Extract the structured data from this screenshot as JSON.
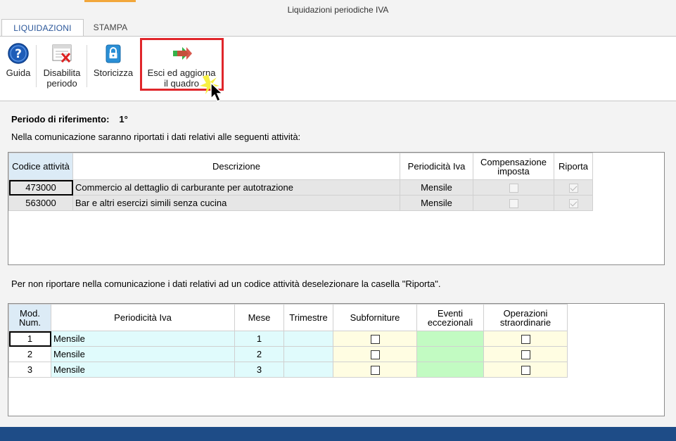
{
  "window": {
    "title": "Liquidazioni periodiche IVA"
  },
  "tabs": [
    {
      "label": "LIQUIDAZIONI",
      "active": true
    },
    {
      "label": "STAMPA",
      "active": false
    }
  ],
  "ribbon": {
    "guida": {
      "label": "Guida",
      "icon": "help-icon"
    },
    "disabilita": {
      "line1": "Disabilita",
      "line2": "periodo",
      "icon": "disable-period-icon"
    },
    "storicizza": {
      "label": "Storicizza",
      "icon": "lock-icon"
    },
    "esci": {
      "line1": "Esci ed aggiorna",
      "line2": "il quadro",
      "icon": "arrow-right-icon"
    }
  },
  "content": {
    "ref_label": "Periodo di riferimento:",
    "ref_value": "1°",
    "note1": "Nella comunicazione saranno riportati i dati relativi alle seguenti attività:",
    "note2": "Per non riportare nella comunicazione i dati relativi ad un codice attività deselezionare la casella \"Riporta\"."
  },
  "activities": {
    "headers": {
      "codice": "Codice attività",
      "descrizione": "Descrizione",
      "periodicita": "Periodicità Iva",
      "compensazione": "Compensazione imposta",
      "riporta": "Riporta"
    },
    "rows": [
      {
        "codice": "473000",
        "descrizione": "Commercio al dettaglio di carburante per autotrazione",
        "periodicita": "Mensile",
        "compensazione": false,
        "riporta": true
      },
      {
        "codice": "563000",
        "descrizione": "Bar e altri esercizi simili senza cucina",
        "periodicita": "Mensile",
        "compensazione": false,
        "riporta": true
      }
    ]
  },
  "models": {
    "headers": {
      "mod": "Mod. Num.",
      "periodicita": "Periodicità Iva",
      "mese": "Mese",
      "trimestre": "Trimestre",
      "subforniture": "Subforniture",
      "eventi": "Eventi eccezionali",
      "operazioni": "Operazioni straordinarie"
    },
    "rows": [
      {
        "mod": "1",
        "periodicita": "Mensile",
        "mese": "1",
        "trimestre": "",
        "subforniture": false,
        "operazioni": false
      },
      {
        "mod": "2",
        "periodicita": "Mensile",
        "mese": "2",
        "trimestre": "",
        "subforniture": false,
        "operazioni": false
      },
      {
        "mod": "3",
        "periodicita": "Mensile",
        "mese": "3",
        "trimestre": "",
        "subforniture": false,
        "operazioni": false
      }
    ]
  }
}
